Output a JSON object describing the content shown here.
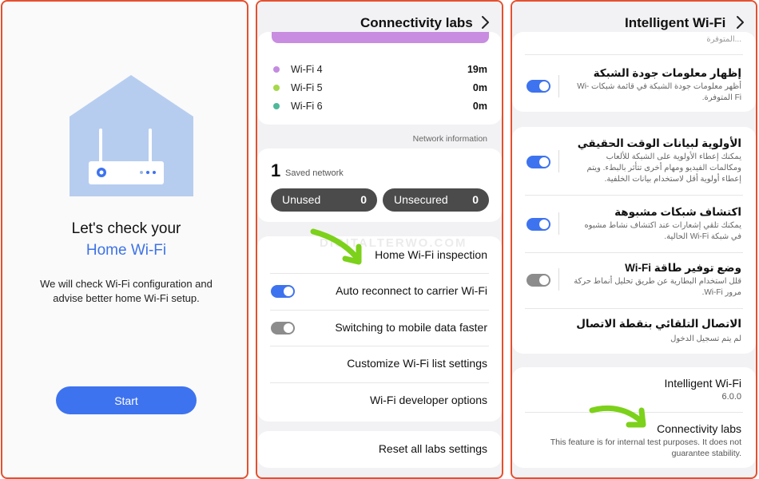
{
  "panel1": {
    "title": "Let's check your",
    "subtitle": "Home Wi-Fi",
    "description": "We will check Wi-Fi configuration and advise better home Wi-Fi setup.",
    "start_label": "Start"
  },
  "panel2": {
    "header_title": "Connectivity labs",
    "wifi_stats": [
      {
        "name": "Wi-Fi 4",
        "value": "19m",
        "color": "#c38ce0"
      },
      {
        "name": "Wi-Fi 5",
        "value": "0m",
        "color": "#a6d84a"
      },
      {
        "name": "Wi-Fi 6",
        "value": "0m",
        "color": "#4fb89a"
      }
    ],
    "network_info_label": "Network information",
    "saved_count": "1",
    "saved_label": "Saved network",
    "unused_label": "Unused",
    "unused_count": "0",
    "unsecured_label": "Unsecured",
    "unsecured_count": "0",
    "menu": {
      "home_inspection": "Home Wi-Fi inspection",
      "auto_reconnect": "Auto reconnect to carrier Wi-Fi",
      "auto_reconnect_on": true,
      "switch_mobile": "Switching to mobile data faster",
      "switch_mobile_on": false,
      "customize_list": "Customize Wi-Fi list settings",
      "developer_options": "Wi-Fi developer options",
      "reset_all": "Reset all labs settings"
    },
    "watermark": "DIGITALTERWO.COM"
  },
  "panel3": {
    "header_title": "Intelligent Wi-Fi",
    "cut_text": "...المتوفرة",
    "items": [
      {
        "title": "إظهار معلومات جودة الشبكة",
        "desc": "أظهر معلومات جودة الشبكة في قائمة شبكات Wi-Fi المتوفرة.",
        "on": true
      },
      {
        "title": "الأولوية لبيانات الوقت الحقيقي",
        "desc": "يمكنك إعطاء الأولوية على الشبكة للألعاب ومكالمات الفيديو ومهام أخرى تتأثر بالبطء. ويتم إعطاء أولوية أقل لاستخدام بيانات الخلفية.",
        "on": true
      },
      {
        "title": "اكتشاف شبكات مشبوهة",
        "desc": "يمكنك تلقي إشعارات عند اكتشاف نشاط مشبوه في شبكة Wi-Fi الحالية.",
        "on": true
      },
      {
        "title": "وضع توفير طاقة Wi-Fi",
        "desc": "قلل استخدام البطارية عن طريق تحليل أنماط حركة مرور Wi-Fi.",
        "on": false
      },
      {
        "title": "الاتصال التلقائي بنقطة الاتصال",
        "desc": "لم يتم تسجيل الدخول",
        "on": null
      }
    ],
    "app_name": "Intelligent Wi-Fi",
    "version": "6.0.0",
    "labs_title": "Connectivity labs",
    "labs_desc": "This feature is for internal test purposes. It does not guarantee stability."
  },
  "colors": {
    "accent": "#3e73ef",
    "annotation_arrow": "#7cd11a",
    "panel_border": "#e5502e"
  }
}
